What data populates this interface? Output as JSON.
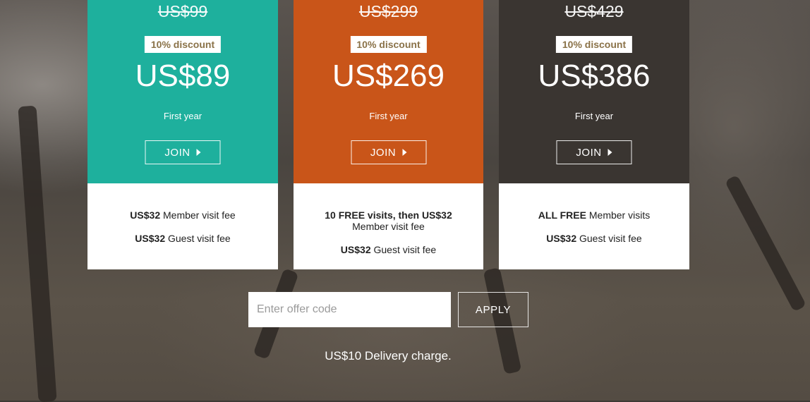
{
  "plans": [
    {
      "old_price": "US$99",
      "discount": "10% discount",
      "price": "US$89",
      "period": "First year",
      "join_label": "JOIN",
      "features": [
        {
          "bold": "US$32",
          "text": " Member visit fee"
        },
        {
          "bold": "US$32",
          "text": " Guest visit fee"
        }
      ],
      "color": "#1eb09d"
    },
    {
      "old_price": "US$299",
      "discount": "10% discount",
      "price": "US$269",
      "period": "First year",
      "join_label": "JOIN",
      "features": [
        {
          "bold": "10 FREE visits, then US$32",
          "text": "Member visit fee"
        },
        {
          "bold": "US$32",
          "text": " Guest visit fee"
        }
      ],
      "color": "#c95519"
    },
    {
      "old_price": "US$429",
      "discount": "10% discount",
      "price": "US$386",
      "period": "First year",
      "join_label": "JOIN",
      "features": [
        {
          "bold": "ALL FREE",
          "text": " Member visits"
        },
        {
          "bold": "US$32",
          "text": " Guest visit fee"
        }
      ],
      "color": "#3a3531"
    }
  ],
  "offer": {
    "placeholder": "Enter offer code",
    "value": "",
    "apply_label": "APPLY"
  },
  "delivery_note": "US$10 Delivery charge."
}
